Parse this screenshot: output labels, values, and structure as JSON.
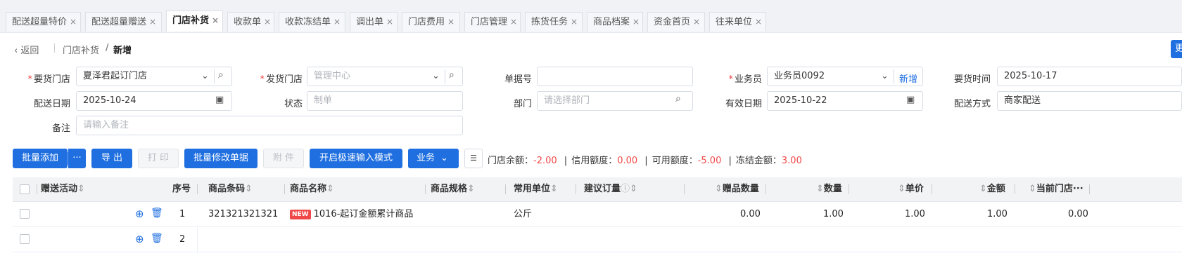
{
  "tabs": [
    {
      "label": "配送超量特价"
    },
    {
      "label": "配送超量赠送"
    },
    {
      "label": "门店补货"
    },
    {
      "label": "收款单"
    },
    {
      "label": "收款冻结单"
    },
    {
      "label": "调出单"
    },
    {
      "label": "门店费用"
    },
    {
      "label": "门店管理"
    },
    {
      "label": "拣货任务"
    },
    {
      "label": "商品档案"
    },
    {
      "label": "资金首页"
    },
    {
      "label": "往来单位"
    }
  ],
  "tab_close": "×",
  "breadcrumb": {
    "back": "返回",
    "parent": "门店补货",
    "sep": "/",
    "current": "新增"
  },
  "corner_button": "更",
  "form": {
    "req_store": {
      "label": "要货门店",
      "value": "夏泽君起订门店"
    },
    "ship_store": {
      "label": "发货门店",
      "placeholder": "管理中心"
    },
    "doc_no": {
      "label": "单据号",
      "value": ""
    },
    "salesman": {
      "label": "业务员",
      "value": "业务员0092",
      "add": "新增"
    },
    "req_time": {
      "label": "要货时间",
      "value": "2025-10-17"
    },
    "ship_date": {
      "label": "配送日期",
      "value": "2025-10-24"
    },
    "status": {
      "label": "状态",
      "placeholder": "制单"
    },
    "dept": {
      "label": "部门",
      "placeholder": "请选择部门"
    },
    "valid_date": {
      "label": "有效日期",
      "value": "2025-10-22"
    },
    "ship_mode": {
      "label": "配送方式",
      "value": "商家配送"
    },
    "remark": {
      "label": "备注",
      "placeholder": "请输入备注"
    }
  },
  "toolbar": {
    "batch_add": "批量添加",
    "more": "···",
    "export": "导 出",
    "print": "打 印",
    "batch_edit": "批量修改单据",
    "attach": "附 件",
    "fast_input": "开启极速输入模式",
    "business": "业务"
  },
  "balance": {
    "store_balance_label": "门店余额：",
    "store_balance": "-2.00",
    "credit_label": "信用额度：",
    "credit": "0.00",
    "available_label": "可用额度：",
    "available": "-5.00",
    "frozen_label": "冻结金额：",
    "frozen": "3.00",
    "divider": "|"
  },
  "colors": {
    "primary": "#1f6fe0",
    "negative": "#f04848",
    "header_bg": "#f2f3f5"
  },
  "table": {
    "headers": {
      "gift": "赠送活动",
      "seq": "序号",
      "barcode": "商品条码",
      "name": "商品名称",
      "spec": "商品规格",
      "unit": "常用单位",
      "suggest": "建议订量",
      "gift_qty": "赠品数量",
      "qty": "数量",
      "price": "单价",
      "amount": "金额",
      "cur_store": "当前门店···"
    },
    "rows": [
      {
        "seq": "1",
        "barcode": "321321321321",
        "badge": "NEW",
        "name": "1016-起订金额累计商品",
        "unit": "公斤",
        "gift_qty": "0.00",
        "qty": "1.00",
        "price": "1.00",
        "amount": "1.00",
        "cur_store": "0.00"
      },
      {
        "seq": "2"
      }
    ]
  }
}
